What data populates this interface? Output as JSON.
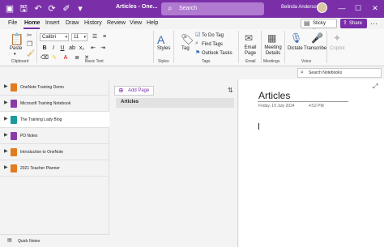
{
  "titlebar": {
    "doc_title": "Articles - One...",
    "search_label": "Search",
    "user_name": "Belinda Anderson",
    "minimize": "—",
    "maximize": "☐",
    "close": "✕"
  },
  "menu": {
    "items": [
      "File",
      "Home",
      "Insert",
      "Draw",
      "History",
      "Review",
      "View",
      "Help"
    ],
    "active": "Home",
    "sticky_notes": "Sticky Notes",
    "share": "Share"
  },
  "ribbon": {
    "clipboard": {
      "paste": "Paste",
      "label": "Clipboard"
    },
    "basic_text": {
      "font": "Calibri",
      "size": "11",
      "label": "Basic Text"
    },
    "styles": {
      "button": "Styles",
      "label": "Styles"
    },
    "tags": {
      "tag": "Tag",
      "todo": "To Do Tag",
      "find": "Find Tags",
      "outlook": "Outlook Tasks",
      "label": "Tags"
    },
    "email": {
      "button": "Email Page",
      "label": "Email"
    },
    "meetings": {
      "button": "Meeting Details",
      "label": "Meetings"
    },
    "voice": {
      "dictate": "Dictate",
      "transcribe": "Transcribe",
      "label": "Voice"
    },
    "copilot": {
      "button": "Copilot"
    }
  },
  "search_notebooks": {
    "placeholder": "Search Notebooks"
  },
  "notebooks": [
    {
      "name": "OneNote Training Demo",
      "color": "#e07b1f"
    },
    {
      "name": "Microsoft Training Notebook",
      "color": "#8a3ca8"
    },
    {
      "name": "The Training Lady Blog",
      "color": "#1a9a9a"
    },
    {
      "name": "PD Notes",
      "color": "#8a3ca8"
    },
    {
      "name": "Introduction to OneNote",
      "color": "#e07b1f"
    },
    {
      "name": "2021 Teacher Planner",
      "color": "#e07b1f"
    }
  ],
  "quick_notes": "Quick Notes",
  "pages_panel": {
    "add_page": "Add Page",
    "pages": [
      "Articles"
    ]
  },
  "page": {
    "title": "Articles",
    "date": "Friday, 19 July 2024",
    "time": "4:52 PM"
  },
  "colors": {
    "accent": "#7a2fa8"
  }
}
